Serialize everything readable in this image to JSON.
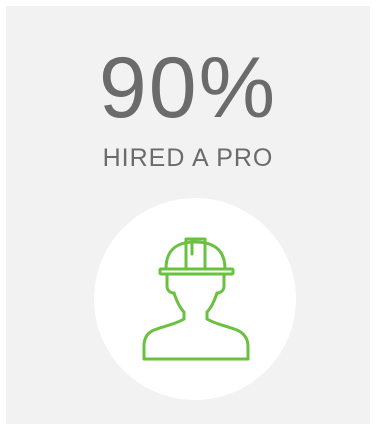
{
  "stat": {
    "value": "90%",
    "label": "HIRED A PRO"
  },
  "icon": {
    "name": "hard-hat-worker-icon",
    "color": "#6ac13f"
  },
  "colors": {
    "card_background": "#f2f2f2",
    "text": "#6b6b6b",
    "circle": "#ffffff"
  }
}
